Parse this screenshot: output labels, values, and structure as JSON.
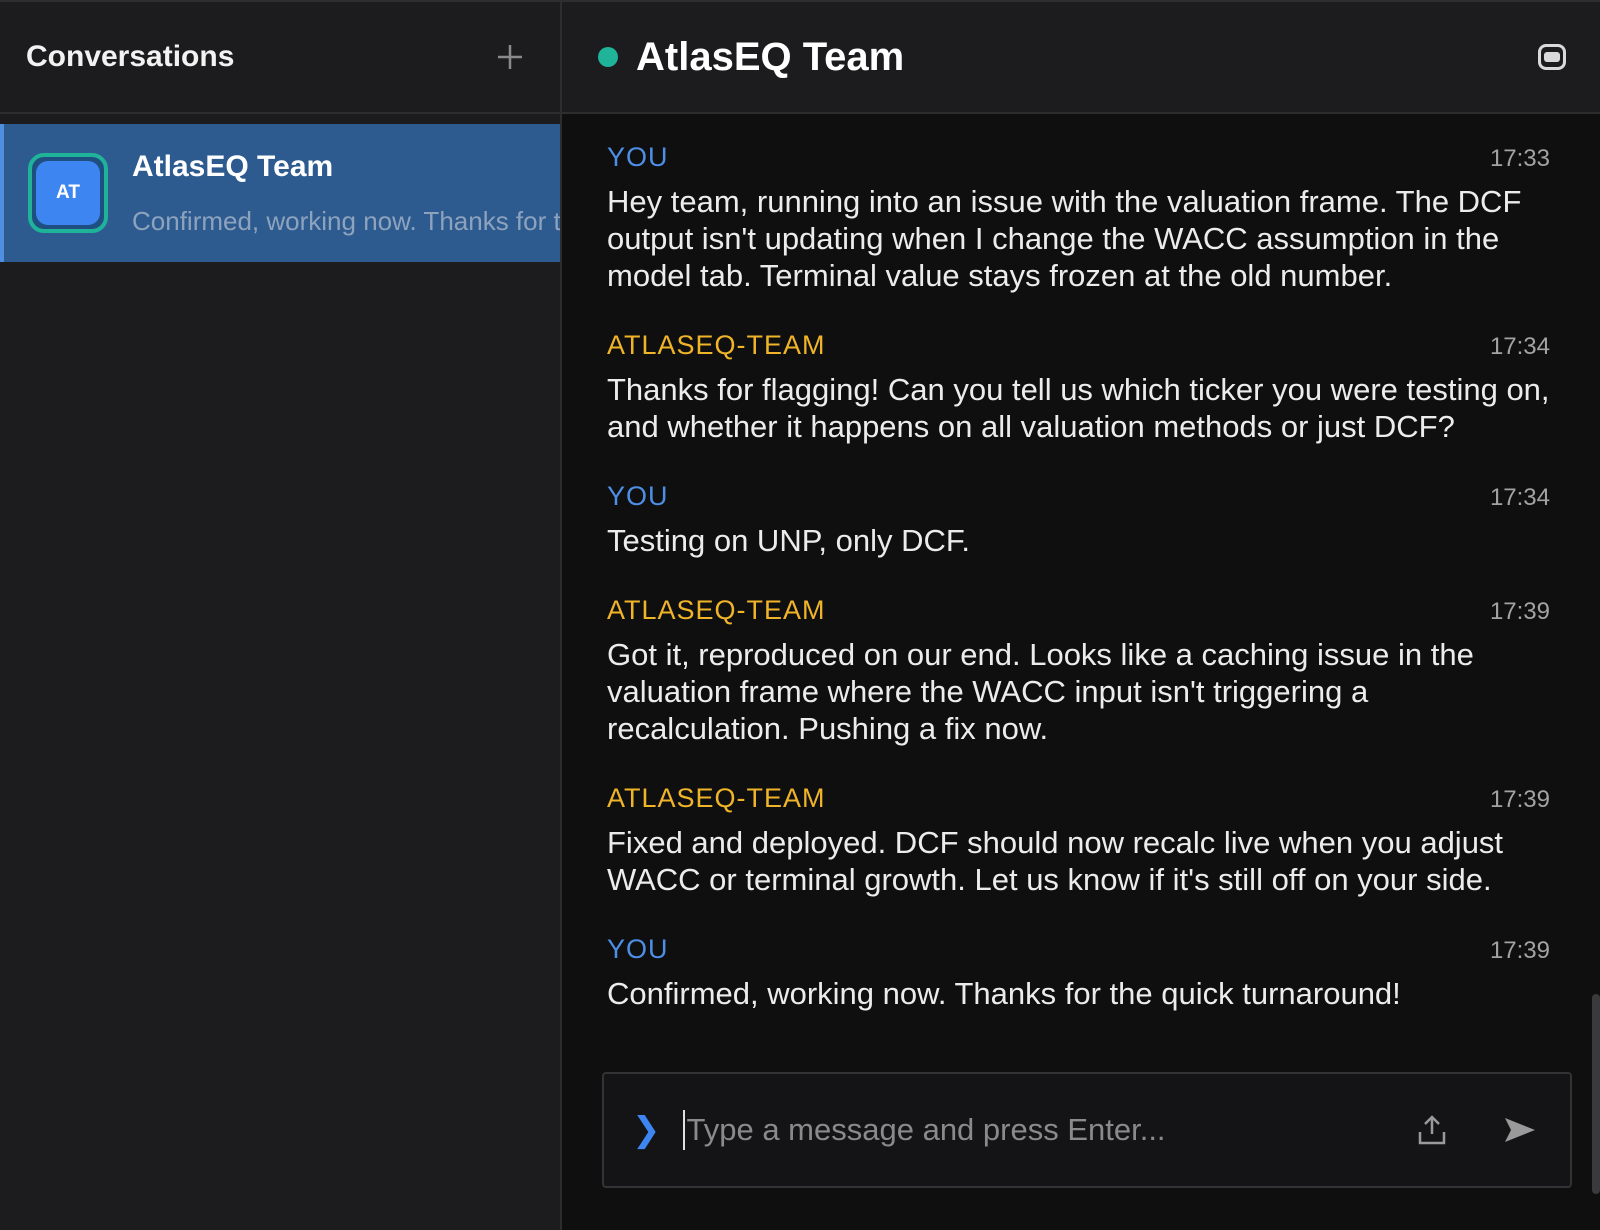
{
  "sidebar": {
    "title": "Conversations",
    "conversations": [
      {
        "initials": "AT",
        "name": "AtlasEQ Team",
        "preview": "Confirmed, working now. Thanks for the quick turnaround!"
      }
    ]
  },
  "chat": {
    "title": "AtlasEQ Team",
    "status_color": "#1fb39a",
    "messages": [
      {
        "sender": "YOU",
        "time": "17:33",
        "text": "Hey team, running into an issue with the valuation frame. The DCF output isn't updating when I change the WACC assumption in the model tab. Terminal value stays frozen at the old number."
      },
      {
        "sender": "ATLASEQ-TEAM",
        "time": "17:34",
        "text": "Thanks for flagging! Can you tell us which ticker you were testing on, and whether it happens on all valuation methods or just DCF?"
      },
      {
        "sender": "YOU",
        "time": "17:34",
        "text": "Testing on UNP, only DCF."
      },
      {
        "sender": "ATLASEQ-TEAM",
        "time": "17:39",
        "text": "Got it, reproduced on our end. Looks like a caching issue in the valuation frame where the WACC input isn't triggering a recalculation. Pushing a fix now."
      },
      {
        "sender": "ATLASEQ-TEAM",
        "time": "17:39",
        "text": "Fixed and deployed. DCF should now recalc live when you adjust WACC or terminal growth. Let us know if it's still off on your side."
      },
      {
        "sender": "YOU",
        "time": "17:39",
        "text": "Confirmed, working now. Thanks for the quick turnaround!"
      }
    ]
  },
  "composer": {
    "placeholder": "Type a message and press Enter...",
    "value": "",
    "prompt_icon": "chevron-right-icon",
    "upload_icon": "upload-icon",
    "send_icon": "send-icon"
  },
  "colors": {
    "you": "#4e8fe6",
    "team": "#f0b429",
    "accent": "#3d85f0",
    "selected": "#2e5b8f"
  }
}
